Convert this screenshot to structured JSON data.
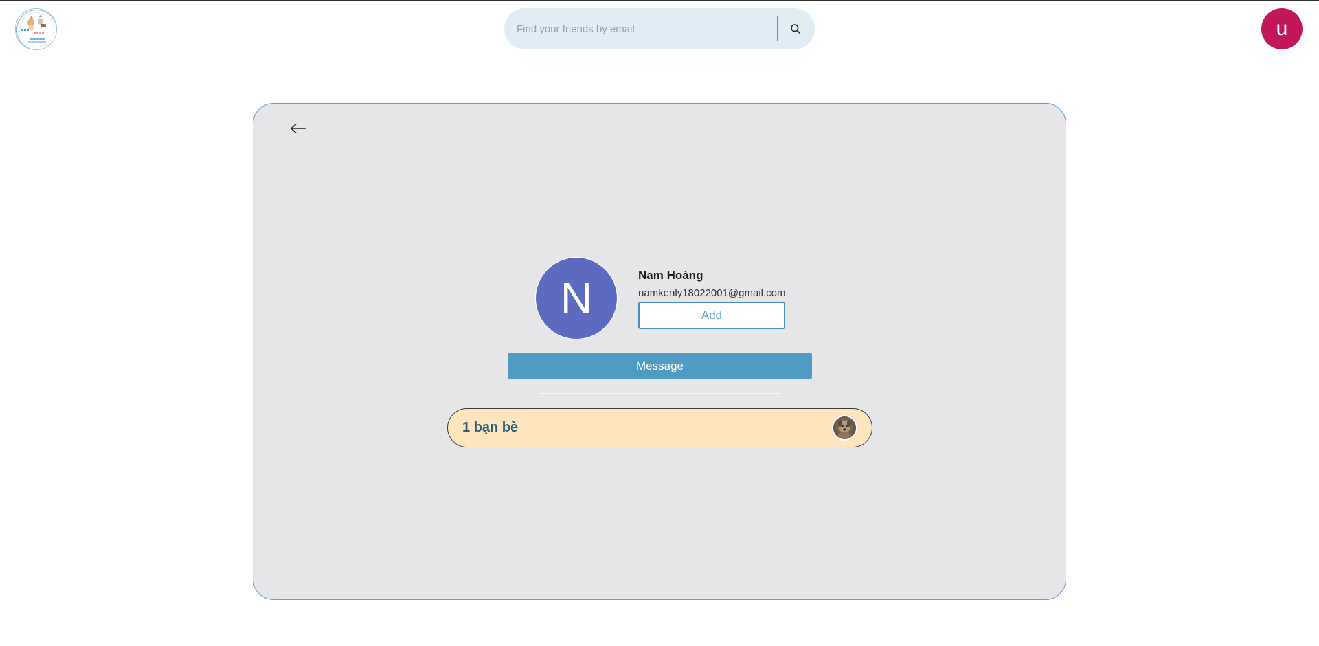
{
  "header": {
    "logo_icon": "cat-logo-icon",
    "search": {
      "placeholder": "Find your friends by email",
      "value": "",
      "icon": "search-icon"
    },
    "user_avatar_letter": "u",
    "user_avatar_color": "#c2185b"
  },
  "profile": {
    "back_icon": "arrow-left-icon",
    "avatar_letter": "N",
    "avatar_color": "#5c6bc0",
    "name": "Nam Hoàng",
    "email": "namkenly18022001@gmail.com",
    "add_label": "Add",
    "message_label": "Message"
  },
  "friends": {
    "label": "1 bạn bè",
    "count": 1,
    "bar_color": "#fde5bd"
  },
  "colors": {
    "accent": "#4f9bc4",
    "card_bg": "#e6e6e9",
    "card_border": "#5b9fd0"
  }
}
